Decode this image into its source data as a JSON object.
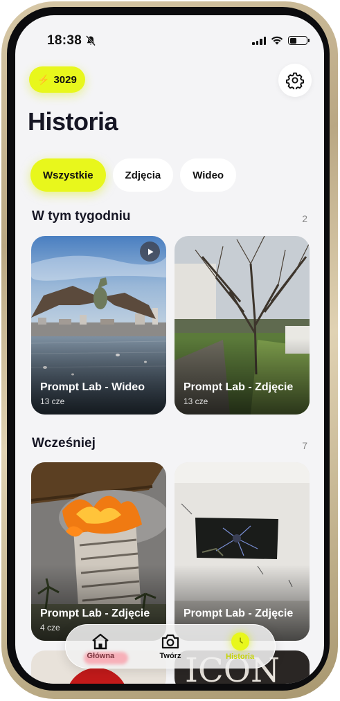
{
  "status_bar": {
    "time": "18:38",
    "battery_level": 0.4
  },
  "header": {
    "credits": "3029",
    "title": "Historia"
  },
  "filters": [
    {
      "label": "Wszystkie",
      "active": true
    },
    {
      "label": "Zdjęcia",
      "active": false
    },
    {
      "label": "Wideo",
      "active": false
    }
  ],
  "sections": {
    "this_week": {
      "title": "W tym tygodniu",
      "count": "2",
      "cards": [
        {
          "title": "Prompt Lab - Wideo",
          "sub": "13 cze",
          "type": "video"
        },
        {
          "title": "Prompt Lab - Zdjęcie",
          "sub": "13 cze",
          "type": "photo"
        }
      ]
    },
    "earlier": {
      "title": "Wcześniej",
      "count": "7",
      "cards": [
        {
          "title": "Prompt Lab - Zdjęcie",
          "sub": "4 cze",
          "type": "photo"
        },
        {
          "title": "Prompt Lab - Zdjęcie",
          "sub": "",
          "type": "photo"
        }
      ]
    }
  },
  "tabbar": {
    "home": "Główna",
    "create": "Twórz",
    "history": "Historia"
  },
  "colors": {
    "accent": "#e8f71c",
    "text": "#161624"
  },
  "icons": [
    "bell-slash-icon",
    "bolt-icon",
    "gear-icon",
    "play-icon",
    "home-icon",
    "camera-icon",
    "history-icon"
  ]
}
